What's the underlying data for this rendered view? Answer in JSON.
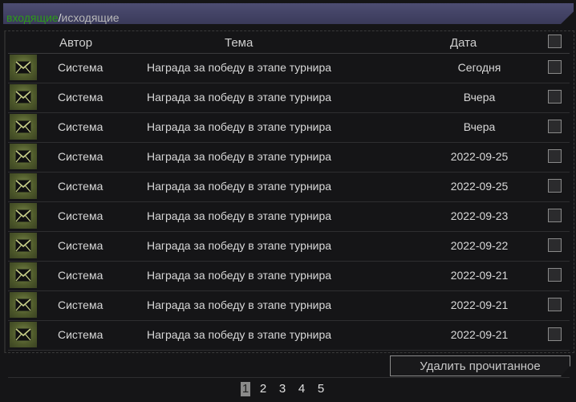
{
  "tabs": {
    "incoming": "входящие",
    "separator": "/",
    "outgoing": "исходящие"
  },
  "columns": {
    "author": "Автор",
    "subject": "Тема",
    "date": "Дата"
  },
  "messages": [
    {
      "author": "Система",
      "subject": "Награда за победу в этапе турнира",
      "date": "Сегодня"
    },
    {
      "author": "Система",
      "subject": "Награда за победу в этапе турнира",
      "date": "Вчера"
    },
    {
      "author": "Система",
      "subject": "Награда за победу в этапе турнира",
      "date": "Вчера"
    },
    {
      "author": "Система",
      "subject": "Награда за победу в этапе турнира",
      "date": "2022-09-25"
    },
    {
      "author": "Система",
      "subject": "Награда за победу в этапе турнира",
      "date": "2022-09-25"
    },
    {
      "author": "Система",
      "subject": "Награда за победу в этапе турнира",
      "date": "2022-09-23"
    },
    {
      "author": "Система",
      "subject": "Награда за победу в этапе турнира",
      "date": "2022-09-22"
    },
    {
      "author": "Система",
      "subject": "Награда за победу в этапе турнира",
      "date": "2022-09-21"
    },
    {
      "author": "Система",
      "subject": "Награда за победу в этапе турнира",
      "date": "2022-09-21"
    },
    {
      "author": "Система",
      "subject": "Награда за победу в этапе турнира",
      "date": "2022-09-21"
    }
  ],
  "actions": {
    "delete_read": "Удалить прочитанное"
  },
  "pagination": {
    "pages": [
      "1",
      "2",
      "3",
      "4",
      "5"
    ],
    "current": "1"
  },
  "icons": {
    "row_icon": "envelope-icon"
  },
  "colors": {
    "incoming_tab": "#2d9a1a",
    "tabbar": "#4d4d72"
  }
}
